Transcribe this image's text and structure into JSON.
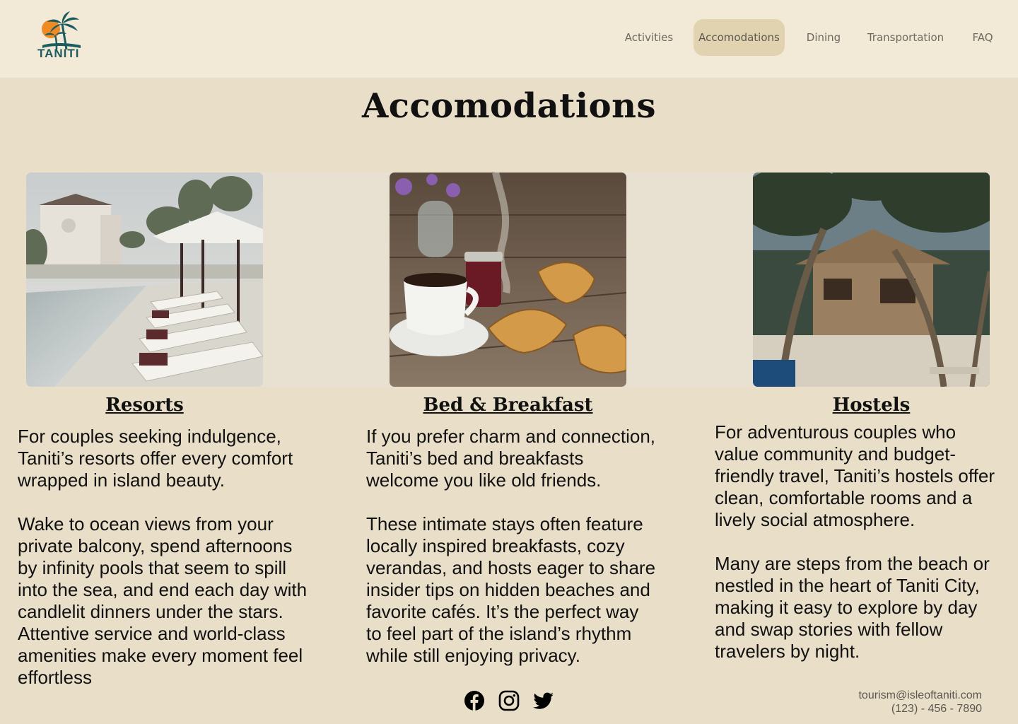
{
  "brand": {
    "name": "TANITI"
  },
  "nav": {
    "items": [
      {
        "label": "Activities"
      },
      {
        "label": "Accomodations",
        "active": true
      },
      {
        "label": "Dining"
      },
      {
        "label": "Transportation"
      },
      {
        "label": "FAQ"
      }
    ]
  },
  "page": {
    "title": "Accomodations"
  },
  "cards": [
    {
      "title": "Resorts",
      "paragraphs": [
        "For couples seeking indulgence, Taniti’s resorts offer every comfort wrapped in island beauty.",
        "Wake to ocean views from your private balcony, spend afternoons by infinity pools that seem to spill into the sea, and end each day with candlelit dinners under the stars. Attentive service and world-class amenities make every moment feel effortless"
      ]
    },
    {
      "title": "Bed & Breakfast",
      "paragraphs": [
        "If you prefer charm and connection, Taniti’s bed and breakfasts welcome you like old friends.",
        "These intimate stays often feature locally inspired breakfasts, cozy verandas, and hosts eager to share insider tips on hidden beaches and favorite cafés. It’s the perfect way to feel part of the island’s rhythm while still enjoying privacy."
      ]
    },
    {
      "title": "Hostels",
      "paragraphs": [
        "For adventurous couples who value community and budget-friendly travel, Taniti’s hostels offer clean, comfortable rooms and a lively social atmosphere.",
        "Many are steps from the beach or nestled in the heart of Taniti City, making it easy to explore by day and swap stories with fellow travelers by night."
      ]
    }
  ],
  "footer": {
    "social": [
      "facebook-icon",
      "instagram-icon",
      "twitter-icon"
    ],
    "email": "tourism@isleoftaniti.com",
    "phone": "(123) - 456 - 7890"
  },
  "colors": {
    "background": "#e9dec7",
    "header": "#f2e9d6",
    "nav_active": "#e2d3b0",
    "logo_teal": "#1c5c5e",
    "logo_sun": "#f08a24"
  }
}
